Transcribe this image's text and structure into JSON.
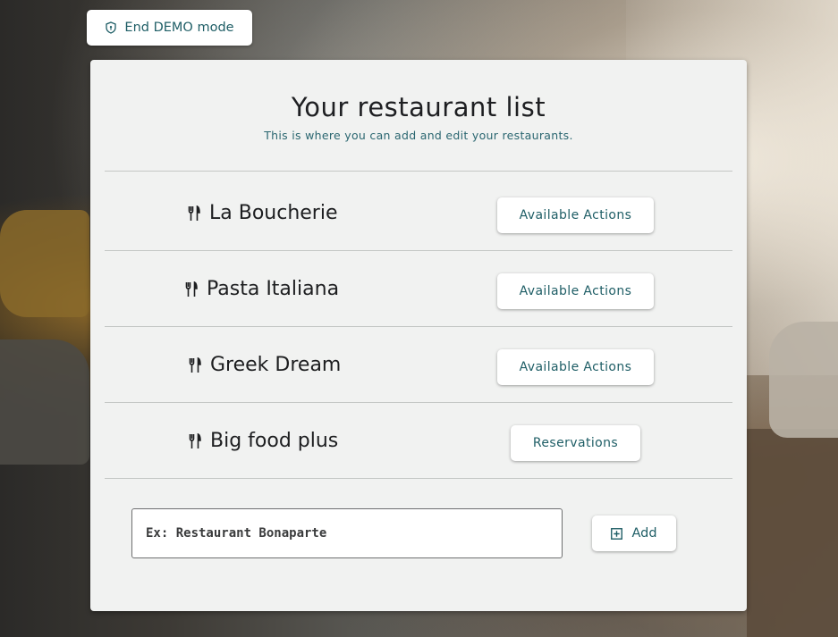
{
  "demo_button": {
    "label": "End DEMO mode",
    "icon": "shield-icon"
  },
  "panel": {
    "title": "Your restaurant list",
    "subtitle": "This is where you can add and edit your restaurants."
  },
  "restaurants": [
    {
      "name": "La Boucherie",
      "icon": "cutlery-icon",
      "action": "Available Actions"
    },
    {
      "name": "Pasta Italiana",
      "icon": "cutlery-icon",
      "action": "Available Actions"
    },
    {
      "name": "Greek Dream",
      "icon": "cutlery-icon",
      "action": "Available Actions"
    },
    {
      "name": "Big food plus",
      "icon": "cutlery-icon",
      "action": "Reservations"
    }
  ],
  "new_restaurant": {
    "placeholder": "Ex: Restaurant Bonaparte",
    "add_label": "Add",
    "add_icon": "plus-square-icon"
  },
  "colors": {
    "accent": "#1f5e66",
    "panel_bg": "#f1f2f1"
  }
}
